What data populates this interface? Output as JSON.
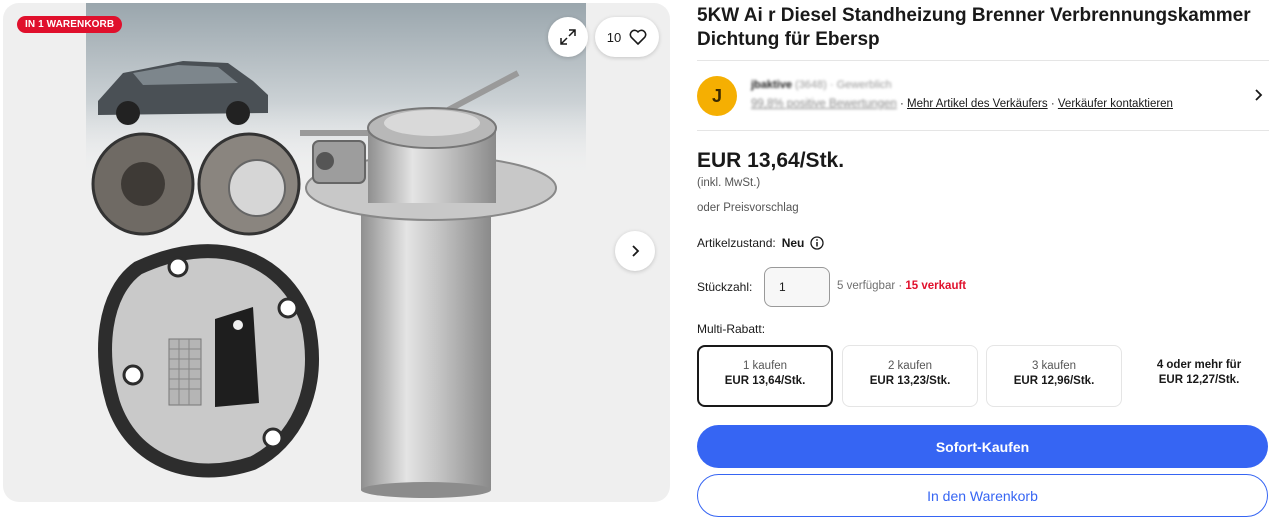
{
  "gallery": {
    "badge": "IN 1 WARENKORB",
    "watch_count": "10",
    "icons": [
      "expand-icon",
      "heart-icon",
      "chevron-right-icon"
    ]
  },
  "product": {
    "title": "5KW Ai r Diesel Standheizung Brenner Verbrennungskammer Dichtung für Ebersp"
  },
  "seller": {
    "initial": "J",
    "name": "jbaktive",
    "feedback_count": "(3648)",
    "type": "· Gewerblich",
    "positive": "99,8% positive Bewertungen",
    "more_items": "Mehr Artikel des Verkäufers",
    "separator": "·",
    "contact": "Verkäufer kontaktieren"
  },
  "pricing": {
    "price": "EUR 13,64/Stk.",
    "vat": "(inkl. MwSt.)",
    "offer": "oder Preisvorschlag"
  },
  "condition": {
    "label": "Artikelzustand:",
    "value": "Neu"
  },
  "quantity": {
    "label": "Stückzahl:",
    "value": "1",
    "available": "5 verfügbar · ",
    "sold": "15 verkauft"
  },
  "multi_discount": {
    "label": "Multi-Rabatt:",
    "tiers": [
      {
        "qty": "1 kaufen",
        "price": "EUR 13,64/Stk."
      },
      {
        "qty": "2 kaufen",
        "price": "EUR 13,23/Stk."
      },
      {
        "qty": "3 kaufen",
        "price": "EUR 12,96/Stk."
      },
      {
        "qty": "4 oder mehr für",
        "price": "EUR 12,27/Stk."
      }
    ]
  },
  "actions": {
    "buy_now": "Sofort-Kaufen",
    "add_to_cart": "In den Warenkorb"
  },
  "colors": {
    "accent": "#3665f3",
    "badge": "#e0102c",
    "avatar": "#f5af02"
  }
}
